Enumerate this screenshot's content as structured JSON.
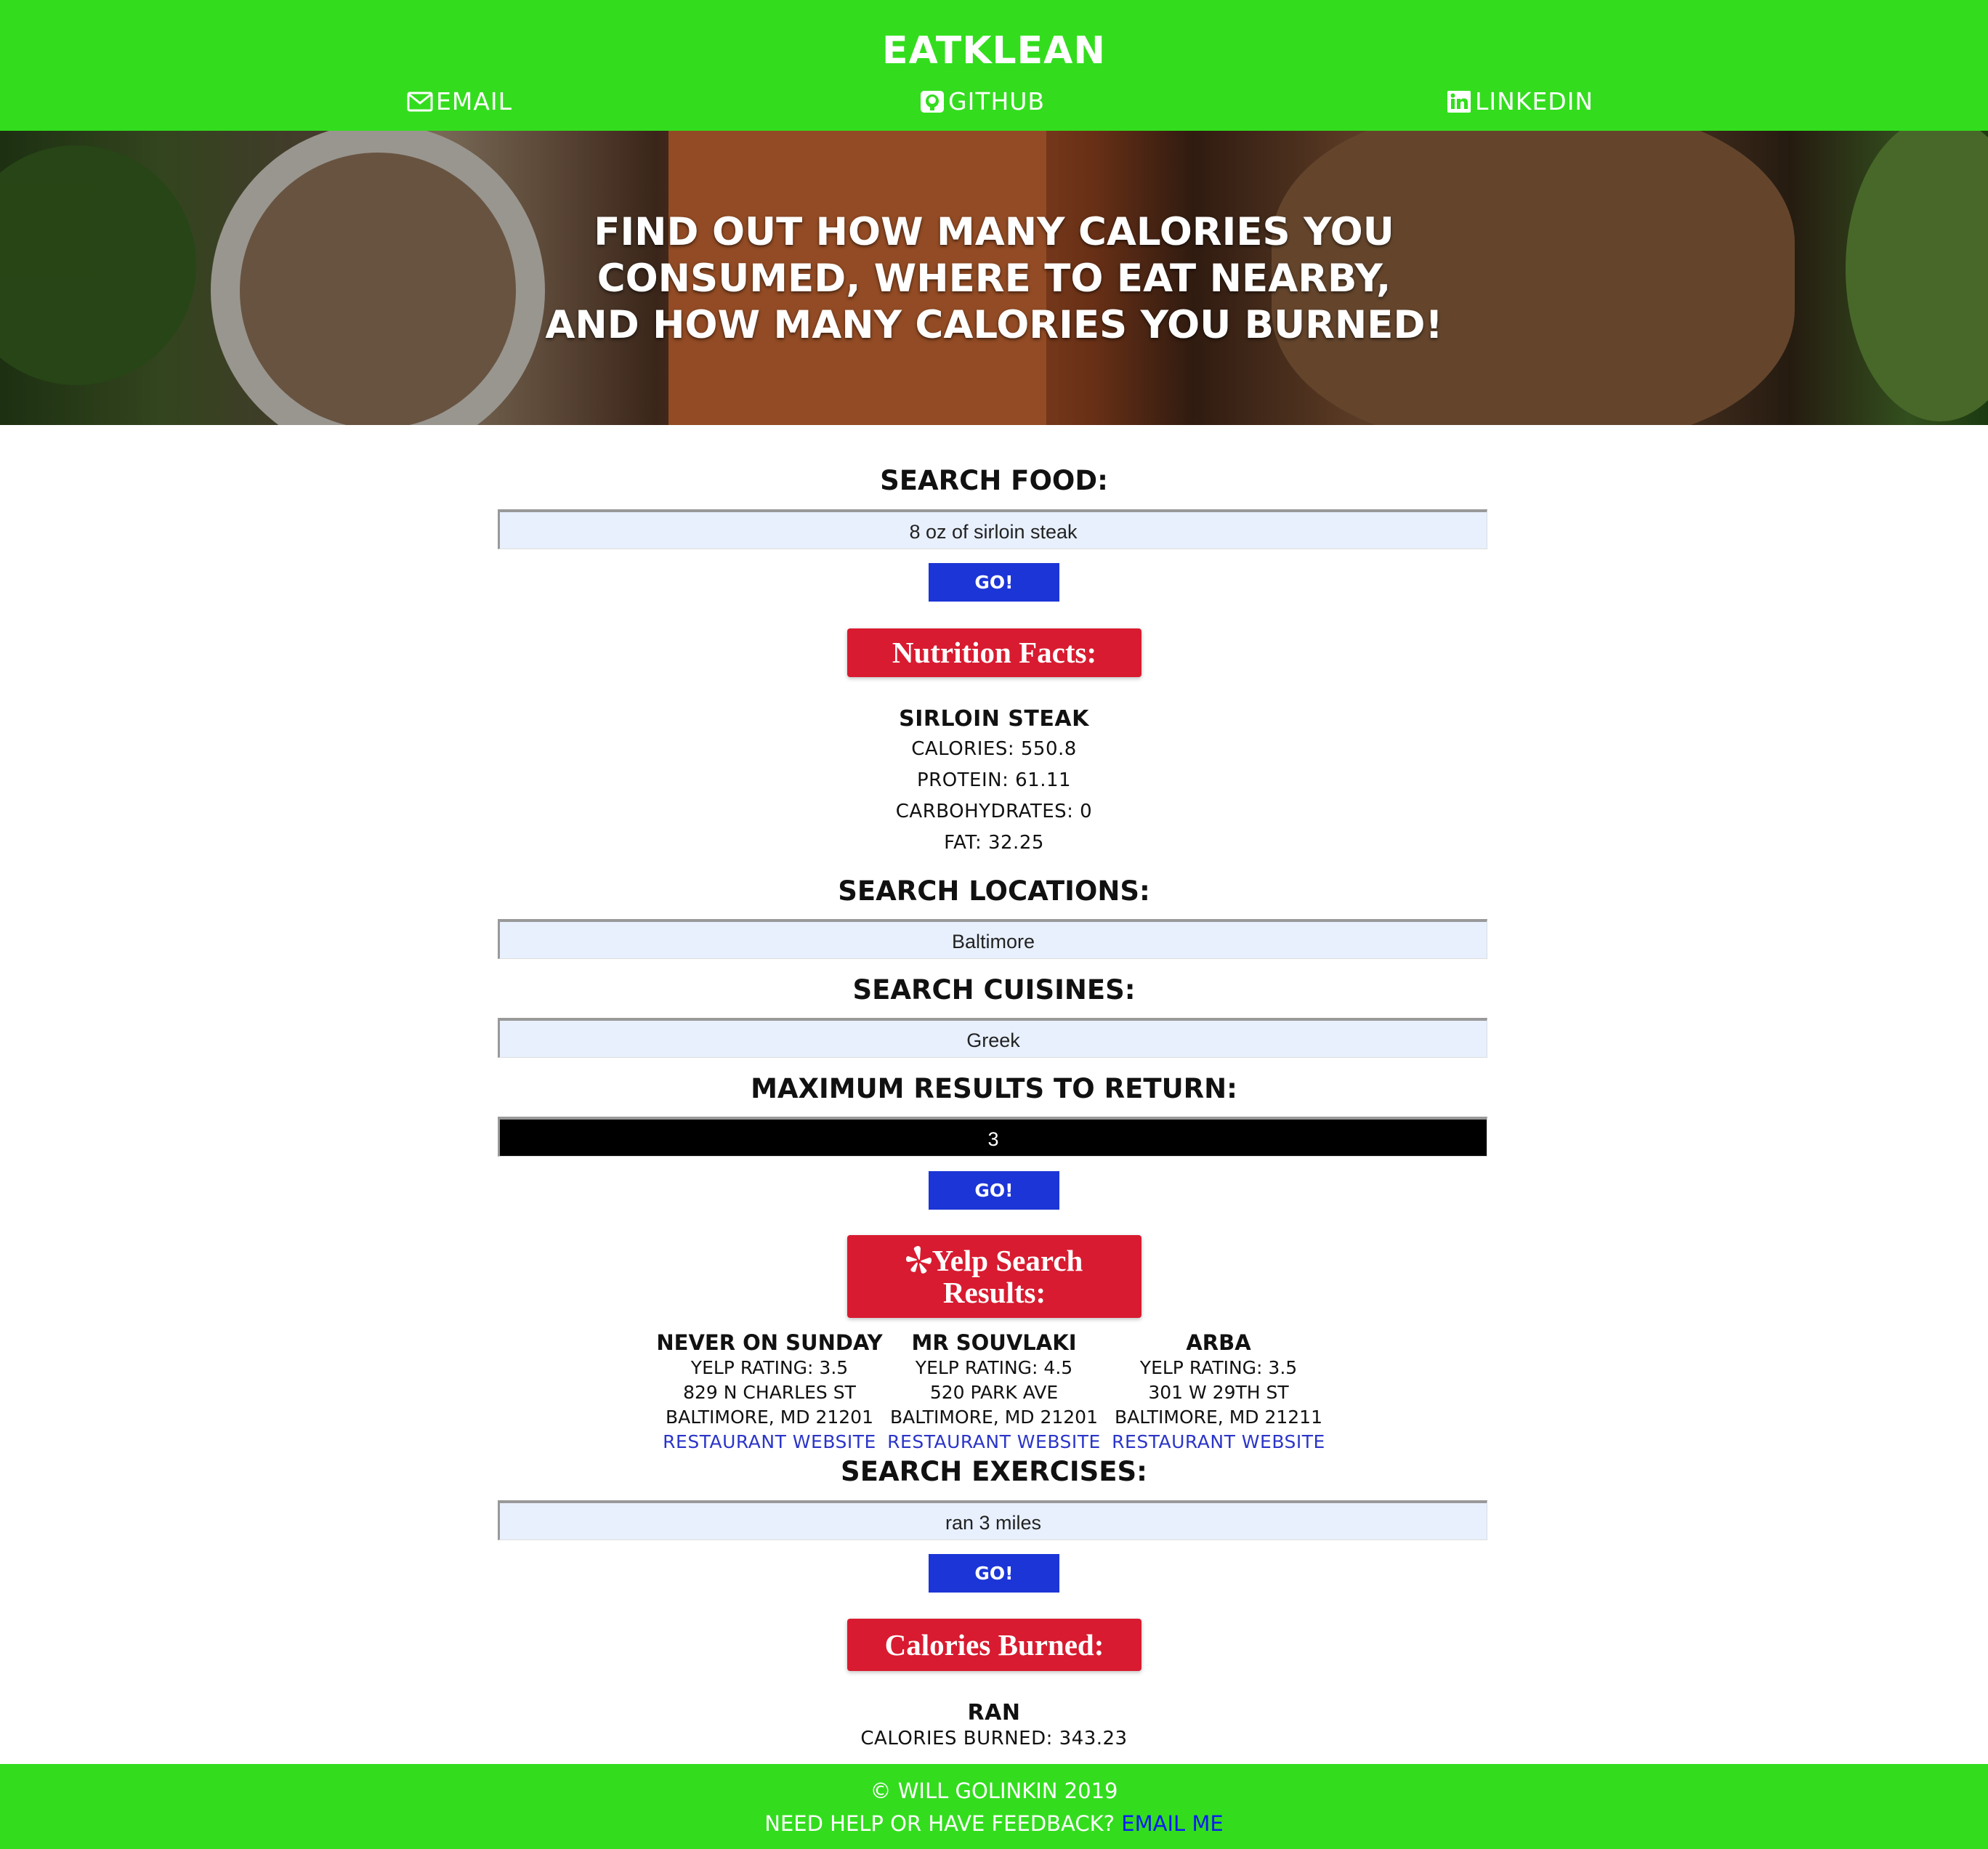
{
  "header": {
    "brand": "EATKLEAN",
    "nav": [
      {
        "label": "EMAIL",
        "icon": "envelope-icon"
      },
      {
        "label": "GITHUB",
        "icon": "github-icon"
      },
      {
        "label": "LINKEDIN",
        "icon": "linkedin-icon"
      }
    ]
  },
  "hero": {
    "lines": [
      "FIND OUT HOW MANY CALORIES YOU",
      "CONSUMED, WHERE TO EAT NEARBY,",
      "AND HOW MANY CALORIES YOU BURNED!"
    ]
  },
  "food_search": {
    "label": "SEARCH FOOD:",
    "value": "8 oz of sirloin steak",
    "button": "GO!"
  },
  "nutrition": {
    "title": "Nutrition Facts:",
    "item": "SIRLOIN STEAK",
    "calories": "CALORIES: 550.8",
    "protein": "PROTEIN: 61.11",
    "carbs": "CARBOHYDRATES: 0",
    "fat": "FAT: 32.25"
  },
  "location_search": {
    "label": "SEARCH LOCATIONS:",
    "value": "Baltimore"
  },
  "cuisine_search": {
    "label": "SEARCH CUISINES:",
    "value": "Greek"
  },
  "max_results": {
    "label": "MAXIMUM RESULTS TO RETURN:",
    "value": "3",
    "button": "GO!"
  },
  "yelp": {
    "title_line1": "Yelp Search",
    "title_line2": "Results:",
    "results": [
      {
        "name": "NEVER ON SUNDAY",
        "rating": "YELP RATING: 3.5",
        "street": "829 N CHARLES ST",
        "city": "BALTIMORE, MD 21201",
        "link": "RESTAURANT WEBSITE"
      },
      {
        "name": "MR SOUVLAKI",
        "rating": "YELP RATING: 4.5",
        "street": "520 PARK AVE",
        "city": "BALTIMORE, MD 21201",
        "link": "RESTAURANT WEBSITE"
      },
      {
        "name": "ARBA",
        "rating": "YELP RATING: 3.5",
        "street": "301 W 29TH ST",
        "city": "BALTIMORE, MD 21211",
        "link": "RESTAURANT WEBSITE"
      }
    ]
  },
  "exercise_search": {
    "label": "SEARCH EXERCISES:",
    "value": "ran 3 miles",
    "button": "GO!"
  },
  "burned": {
    "title": "Calories Burned:",
    "activity": "RAN",
    "calories": "CALORIES BURNED: 343.23"
  },
  "footer": {
    "copyright": "© WILL GOLINKIN 2019",
    "help": "NEED HELP OR HAVE FEEDBACK?",
    "email_link": "EMAIL ME"
  },
  "colors": {
    "header_green": "#33dd1e",
    "button_blue": "#1c35d6",
    "card_red": "#d81b30",
    "link_blue": "#2b35c8"
  }
}
